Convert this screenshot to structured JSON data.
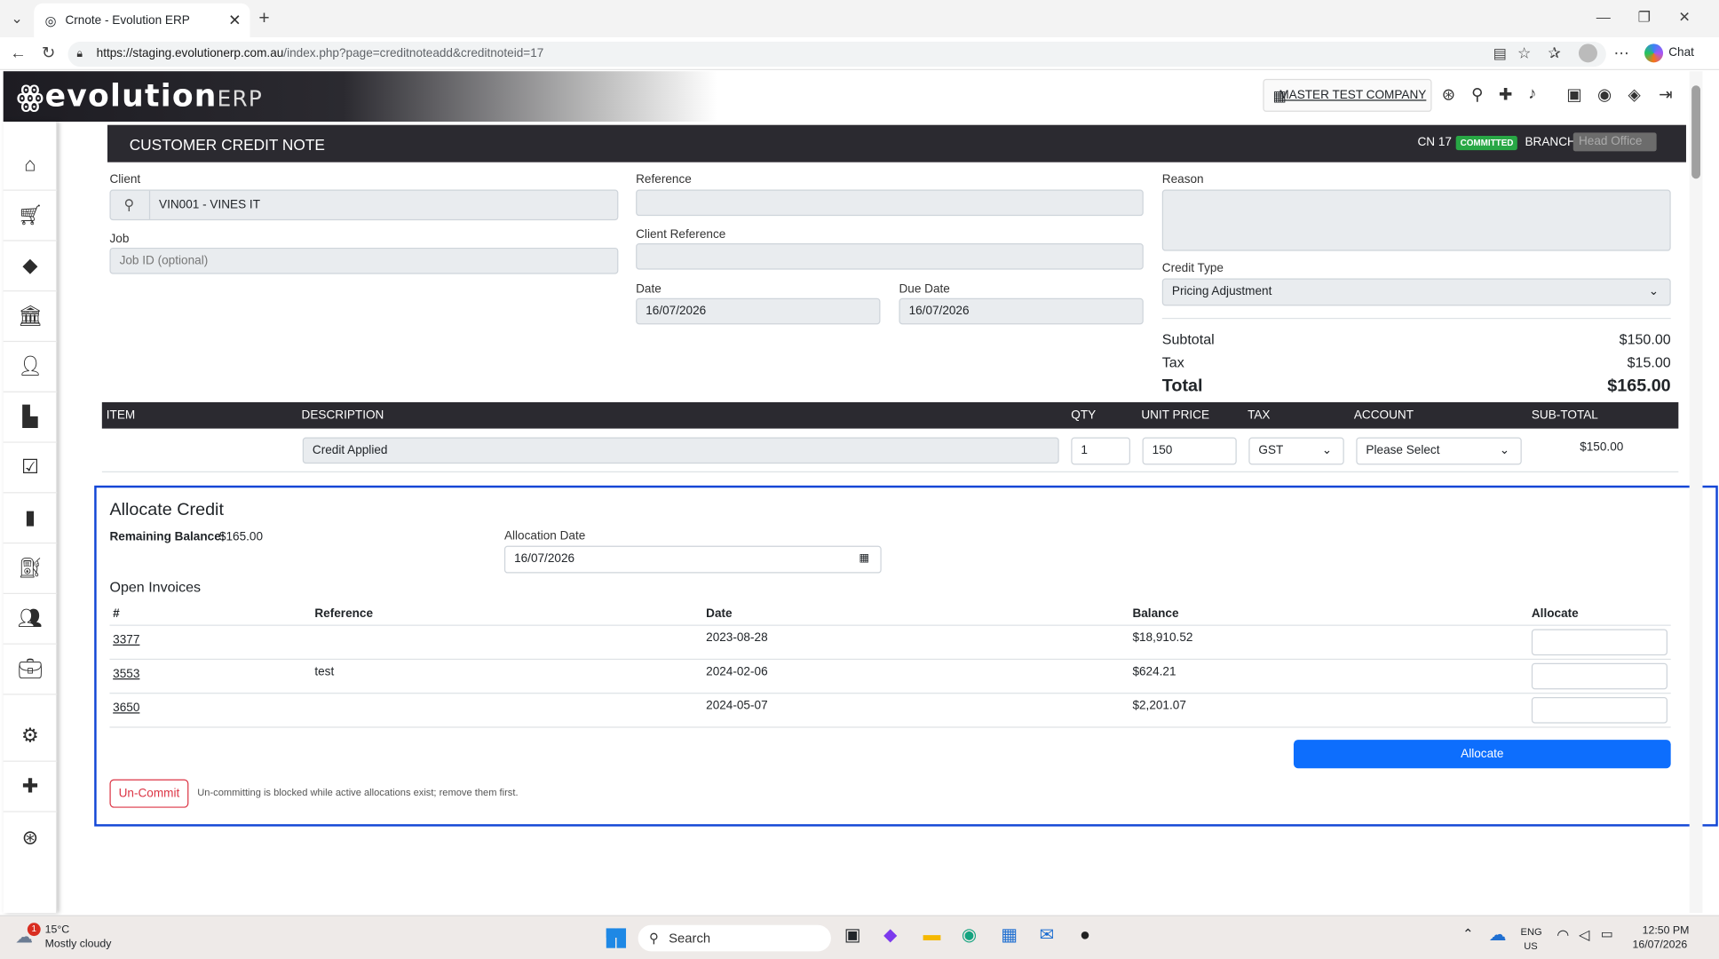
{
  "browser": {
    "tab_title": "Crnote - Evolution ERP",
    "url_host": "https://staging.evolutionerp.com.au",
    "url_path": "/index.php?page=creditnoteadd&creditnoteid=17",
    "chat_label": "Chat"
  },
  "app": {
    "logo": "evolution",
    "logo_suffix": "ERP",
    "company": "MASTER TEST COMPANY"
  },
  "titlebar": {
    "title": "CUSTOMER CREDIT NOTE",
    "cn": "CN 17",
    "status": "COMMITTED",
    "branch_label": "BRANCH",
    "branch_value": "Head Office"
  },
  "form": {
    "client_label": "Client",
    "client_value": "VIN001 - VINES IT",
    "job_label": "Job",
    "job_placeholder": "Job ID (optional)",
    "reference_label": "Reference",
    "reference_value": "",
    "client_ref_label": "Client Reference",
    "client_ref_value": "",
    "date_label": "Date",
    "date_value": "16/07/2026",
    "due_label": "Due Date",
    "due_value": "16/07/2026",
    "reason_label": "Reason",
    "reason_value": "",
    "credit_type_label": "Credit Type",
    "credit_type_value": "Pricing Adjustment"
  },
  "summary": {
    "subtotal_label": "Subtotal",
    "subtotal": "$150.00",
    "tax_label": "Tax",
    "tax": "$15.00",
    "total_label": "Total",
    "total": "$165.00"
  },
  "items": {
    "headers": [
      "ITEM",
      "DESCRIPTION",
      "QTY",
      "UNIT PRICE",
      "TAX",
      "ACCOUNT",
      "SUB-TOTAL"
    ],
    "row": {
      "description": "Credit Applied",
      "qty": "1",
      "unit_price": "150",
      "tax": "GST",
      "account": "Please Select",
      "subtotal": "$150.00"
    }
  },
  "allocate": {
    "title": "Allocate Credit",
    "remaining_label": "Remaining Balance:",
    "remaining_value": "$165.00",
    "alloc_date_label": "Allocation Date",
    "alloc_date_value": "16/07/2026",
    "open_invoices_title": "Open Invoices",
    "headers": [
      "#",
      "Reference",
      "Date",
      "Balance",
      "Allocate"
    ],
    "invoices": [
      {
        "num": "3377",
        "reference": "",
        "date": "2023-08-28",
        "balance": "$18,910.52"
      },
      {
        "num": "3553",
        "reference": "test",
        "date": "2024-02-06",
        "balance": "$624.21"
      },
      {
        "num": "3650",
        "reference": "",
        "date": "2024-05-07",
        "balance": "$2,201.07"
      }
    ],
    "allocate_button": "Allocate",
    "uncommit_button": "Un-Commit",
    "uncommit_note": "Un-committing is blocked while active allocations exist; remove them first."
  },
  "taskbar": {
    "weather_temp": "15°C",
    "weather_desc": "Mostly cloudy",
    "weather_badge": "1",
    "search_placeholder": "Search",
    "lang1": "ENG",
    "lang2": "US",
    "time": "12:50 PM",
    "date": "16/07/2026"
  },
  "colors": {
    "dark_header": "#2b2a30",
    "committed_badge": "#28a745",
    "primary_button": "#0d6efd",
    "danger": "#dc3545",
    "highlight_border": "#1246d6"
  }
}
